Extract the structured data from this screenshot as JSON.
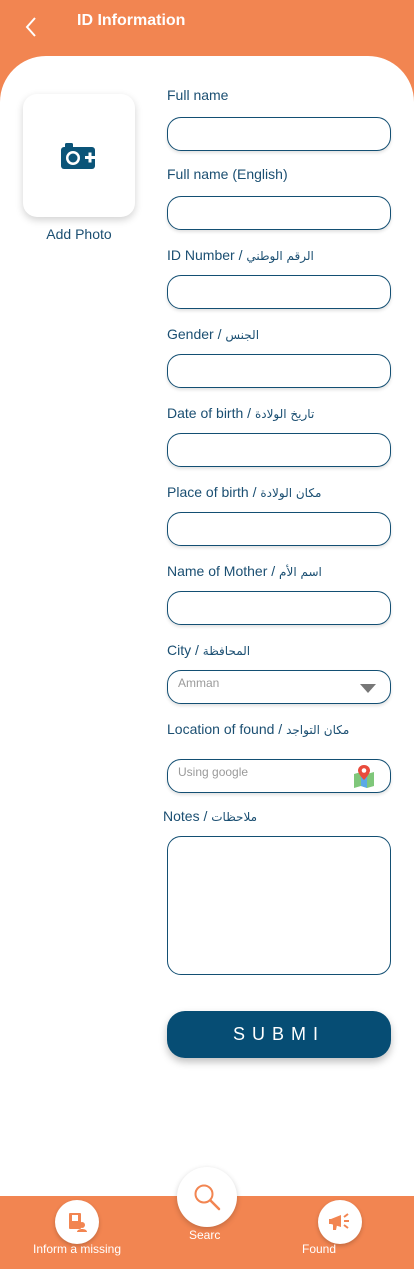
{
  "header": {
    "title": "ID Information"
  },
  "photo": {
    "label": "Add Photo"
  },
  "form": {
    "full_name": {
      "label": "Full name",
      "value": ""
    },
    "full_name_en": {
      "label": "Full name (English)",
      "value": ""
    },
    "id_number": {
      "label_en": "ID Number / ",
      "label_ar": "الرقم الوطني",
      "value": ""
    },
    "gender": {
      "label_en": "Gender /  ",
      "label_ar": "الجنس",
      "value": ""
    },
    "dob": {
      "label_en": "Date of birth / ",
      "label_ar": "تاريخ الولادة",
      "value": ""
    },
    "pob": {
      "label_en": "Place of birth / ",
      "label_ar": "مكان الولادة",
      "value": ""
    },
    "mother": {
      "label_en": "Name of Mother / ",
      "label_ar": "اسم الأم",
      "value": ""
    },
    "city": {
      "label_en": "City / ",
      "label_ar": "المحافظة",
      "selected": "Amman"
    },
    "location": {
      "label_en": "Location of found / ",
      "label_ar": "مكان التواجد",
      "placeholder": "Using google"
    },
    "notes": {
      "label_en": "Notes / ",
      "label_ar": "ملاحظات",
      "value": ""
    }
  },
  "submit": {
    "label": "SUBMI"
  },
  "nav": {
    "inform": {
      "label": "Inform a missing"
    },
    "search": {
      "label": "Searc"
    },
    "found": {
      "label": "Found"
    }
  },
  "colors": {
    "accent": "#f28551",
    "primary": "#064d74",
    "text": "#1b4f72"
  }
}
